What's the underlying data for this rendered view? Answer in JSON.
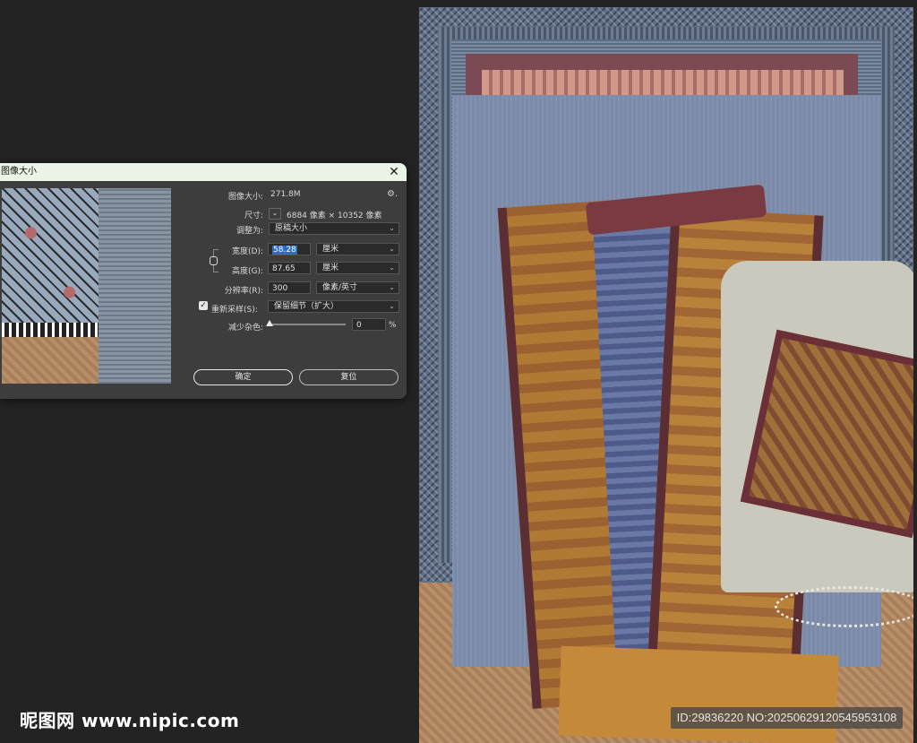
{
  "dialog": {
    "title": "图像大小",
    "close_glyph": "✕",
    "image_size_label": "图像大小:",
    "image_size_value": "271.8M",
    "dimensions_label": "尺寸:",
    "dimensions_value": "6884 像素 × 10352 像素",
    "fit_to_label": "调整为:",
    "fit_to_value": "原稿大小",
    "width_label": "宽度(D):",
    "width_value": "58.28",
    "width_unit": "厘米",
    "height_label": "高度(G):",
    "height_value": "87.65",
    "height_unit": "厘米",
    "resolution_label": "分辨率(R):",
    "resolution_value": "300",
    "resolution_unit": "像素/英寸",
    "resample_label": "重新采样(S):",
    "resample_checked": true,
    "resample_value": "保留细节（扩大）",
    "reduce_noise_label": "减少杂色:",
    "reduce_noise_value": "0",
    "reduce_noise_unit": "%",
    "ok_label": "确定",
    "reset_label": "复位",
    "dropdown_glyph": "⌄",
    "gear_glyph": "⚙."
  },
  "canvas": {
    "id_badge": "ID:29836220 NO:20250629120545953108",
    "watermark": "昵图网 www.nipic.com"
  },
  "colors": {
    "workspace_bg": "#232323",
    "dialog_bg": "#3d3d3d",
    "titlebar_bg": "#ecf4e6",
    "selection": "#2d6cc8"
  }
}
